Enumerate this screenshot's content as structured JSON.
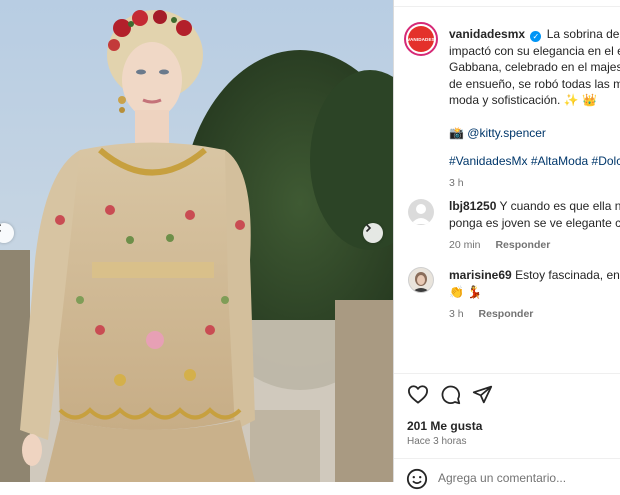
{
  "post": {
    "username": "vanidadesmx",
    "avatar_text": "VANIDADES",
    "caption_lines": [
      "La sobrina de la p",
      "impactó con su elegancia en el es",
      "Gabbana, celebrado en el majestu",
      "de ensueño, se robó todas las mir",
      "moda y sofisticación. ✨ 👑"
    ],
    "mention": "📸 @kitty.spencer",
    "hashtags": "#VanidadesMx #AltaModa #Dolce",
    "time": "3 h"
  },
  "comments": [
    {
      "username": "lbj81250",
      "text_line1": "Y cuando es que ella no",
      "text_line2": "ponga es joven se ve elegante con",
      "time": "20 min",
      "reply_label": "Responder"
    },
    {
      "username": "marisine69",
      "text_line1": "Estoy fascinada, encan",
      "text_line2": "👏 💃",
      "time": "3 h",
      "reply_label": "Responder"
    }
  ],
  "footer": {
    "likes": "201 Me gusta",
    "time_ago": "Hace 3 horas",
    "comment_placeholder": "Agrega un comentario..."
  },
  "icons": {
    "like": "heart-icon",
    "comment": "comment-icon",
    "share": "share-icon",
    "emoji": "emoji-icon",
    "prev": "chevron-left-icon",
    "next": "chevron-right-icon"
  },
  "colors": {
    "brand_red": "#e4312b",
    "link": "#00376b",
    "meta_gray": "#737373",
    "verified_blue": "#0095f6"
  }
}
